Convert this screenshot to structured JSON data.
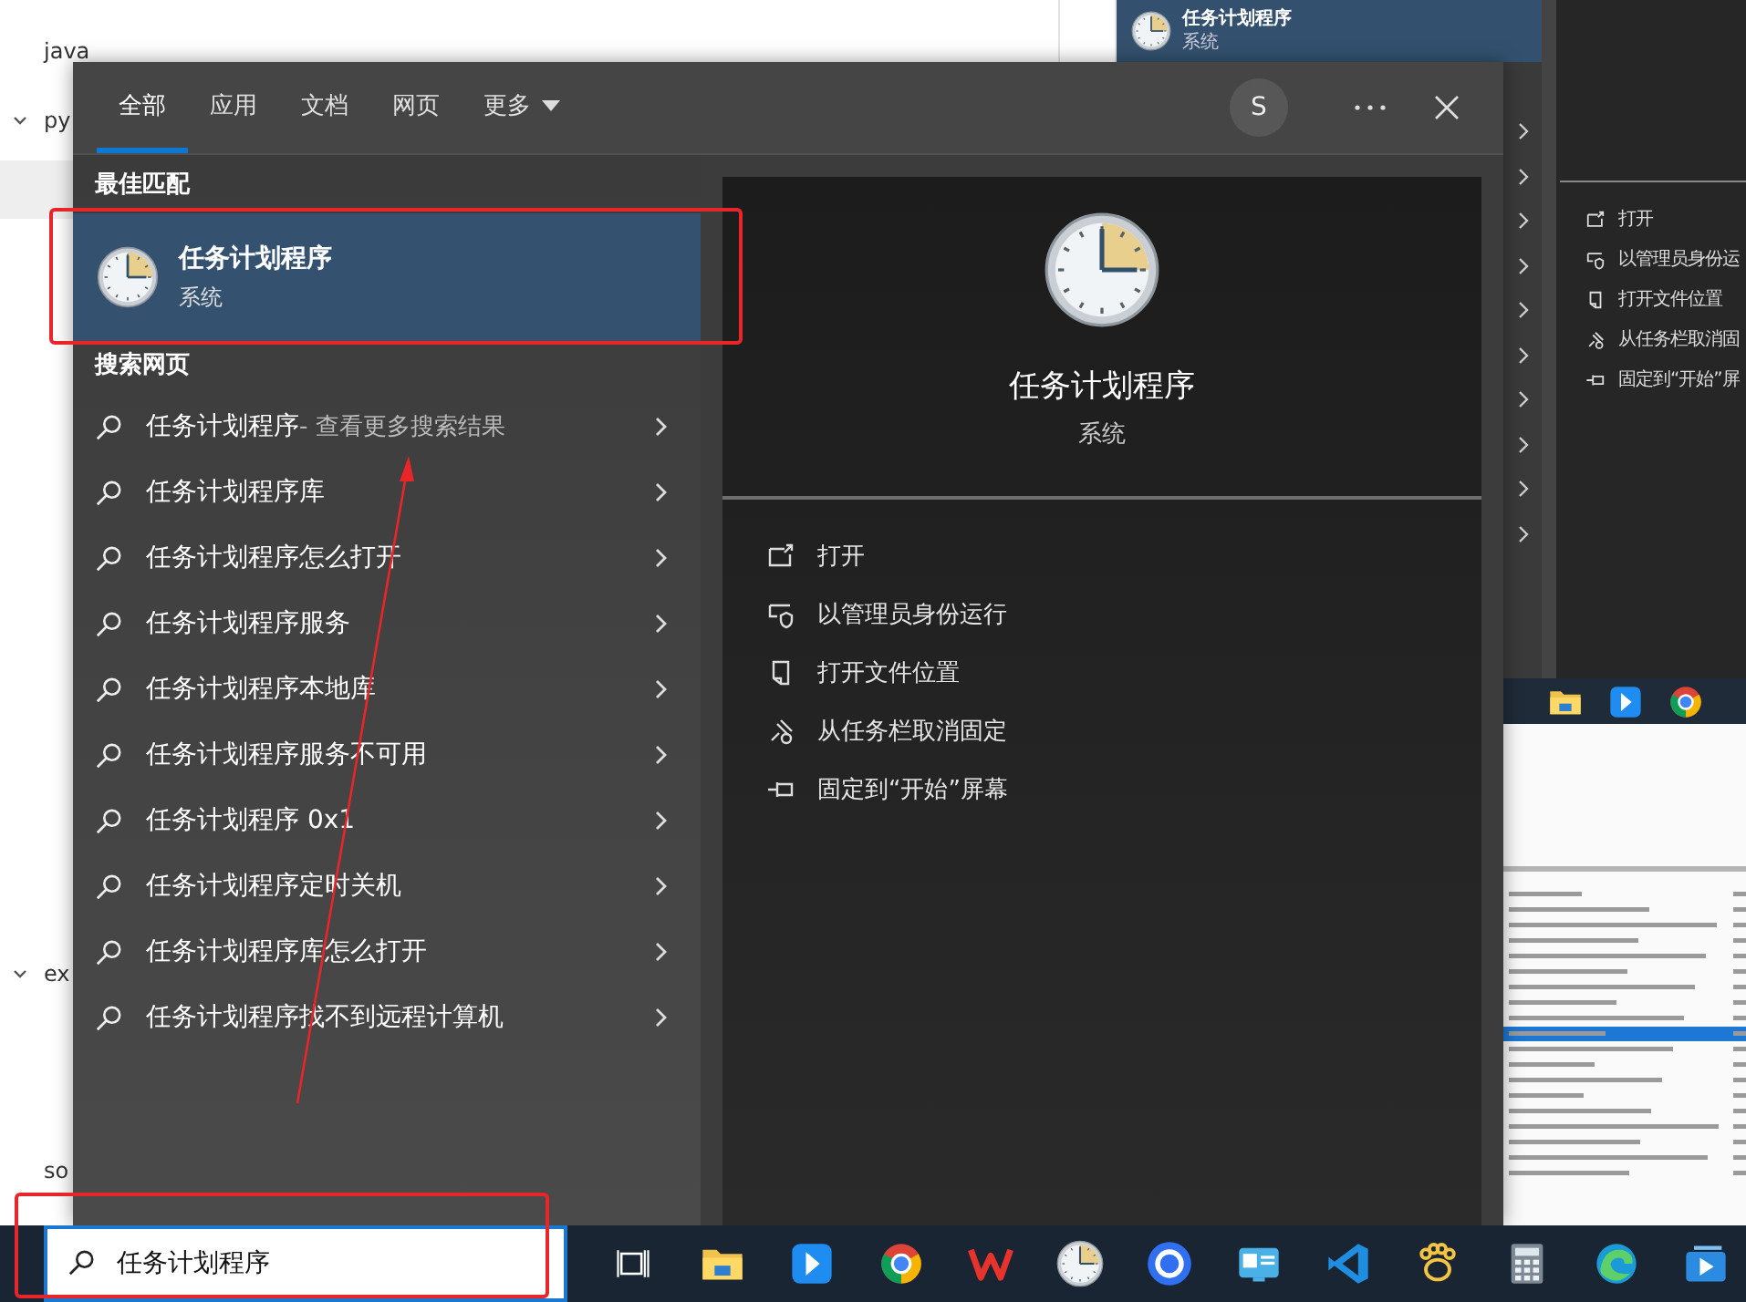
{
  "explorer": {
    "tree": [
      {
        "label": "java",
        "expanded": false
      },
      {
        "label": "py",
        "expanded": true
      },
      {
        "label": "ex",
        "expanded": true
      },
      {
        "label": "so",
        "expanded": false
      }
    ]
  },
  "back_search": {
    "best_match": {
      "title": "任务计划程序",
      "subtitle": "系统"
    },
    "actions": [
      {
        "kind": "open",
        "label": "打开"
      },
      {
        "kind": "admin",
        "label": "以管理员身份运"
      },
      {
        "kind": "location",
        "label": "打开文件位置"
      },
      {
        "kind": "unpin",
        "label": "从任务栏取消固"
      },
      {
        "kind": "pin",
        "label": "固定到“开始”屏"
      }
    ]
  },
  "search_panel": {
    "tabs": [
      {
        "label": "全部",
        "selected": true
      },
      {
        "label": "应用",
        "selected": false
      },
      {
        "label": "文档",
        "selected": false
      },
      {
        "label": "网页",
        "selected": false
      }
    ],
    "more": "更多",
    "avatar": "S",
    "best_match_heading": "最佳匹配",
    "best_match": {
      "title": "任务计划程序",
      "subtitle": "系统",
      "selected": true
    },
    "web_heading": "搜索网页",
    "web_results": [
      {
        "query": "任务计划程序",
        "hint": "- 查看更多搜索结果"
      },
      {
        "query": "任务计划程序库"
      },
      {
        "query": "任务计划程序怎么打开"
      },
      {
        "query": "任务计划程序服务"
      },
      {
        "query": "任务计划程序本地库"
      },
      {
        "query": "任务计划程序服务不可用"
      },
      {
        "query": "任务计划程序 0x1"
      },
      {
        "query": "任务计划程序定时关机"
      },
      {
        "query": "任务计划程序库怎么打开"
      },
      {
        "query": "任务计划程序找不到远程计算机"
      }
    ],
    "detail": {
      "title": "任务计划程序",
      "subtitle": "系统",
      "actions": [
        {
          "kind": "open",
          "label": "打开"
        },
        {
          "kind": "admin",
          "label": "以管理员身份运行"
        },
        {
          "kind": "location",
          "label": "打开文件位置"
        },
        {
          "kind": "unpin",
          "label": "从任务栏取消固定"
        },
        {
          "kind": "pin",
          "label": "固定到“开始”屏幕"
        }
      ]
    }
  },
  "taskbar": {
    "search": {
      "value": "任务计划程序"
    },
    "apps": [
      {
        "kind": "task-view"
      },
      {
        "kind": "folder"
      },
      {
        "kind": "arrow-app"
      },
      {
        "kind": "browser"
      },
      {
        "kind": "zigzag"
      },
      {
        "kind": "clock"
      },
      {
        "kind": "ring"
      },
      {
        "kind": "card"
      },
      {
        "kind": "ribbon"
      },
      {
        "kind": "paw"
      },
      {
        "kind": "calculator"
      },
      {
        "kind": "swirl"
      },
      {
        "kind": "play-window"
      }
    ]
  }
}
